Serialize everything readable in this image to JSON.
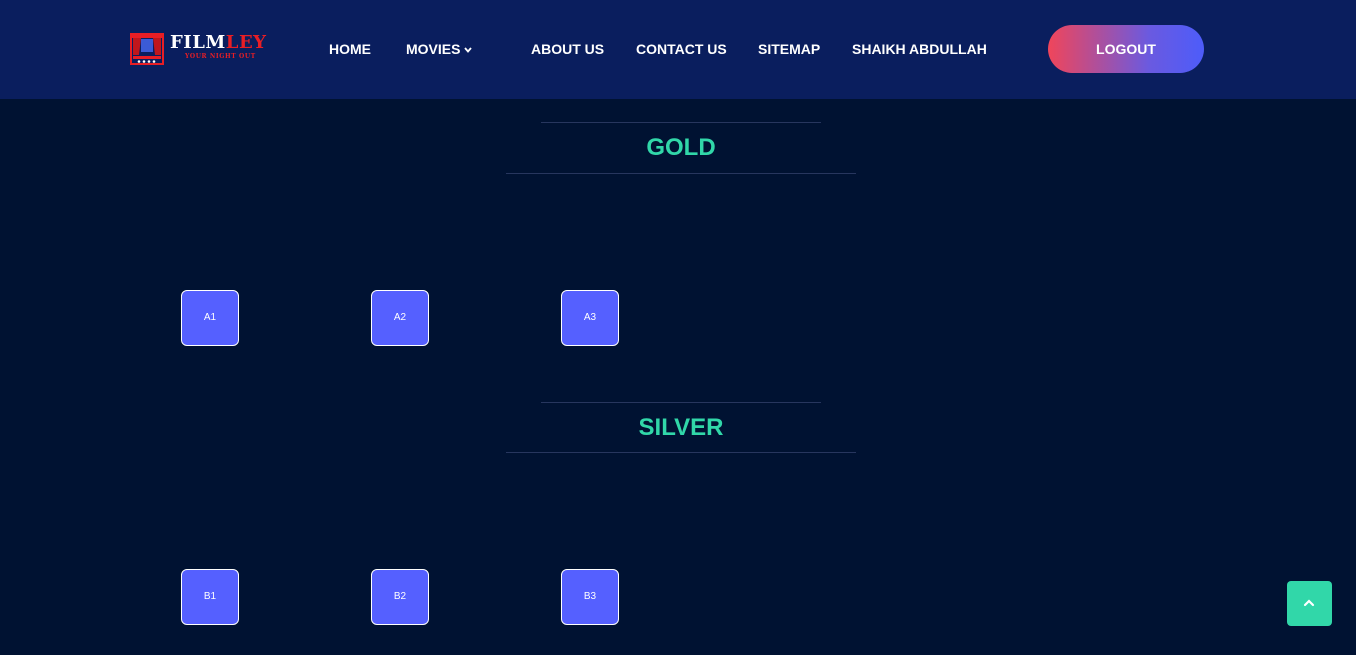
{
  "header": {
    "logo": {
      "word_part1": "FILM",
      "word_part2": "LEY",
      "tagline": "YOUR NIGHT OUT"
    },
    "nav": {
      "home": "HOME",
      "movies": "MOVIES",
      "about": "ABOUT US",
      "contact": "CONTACT US",
      "sitemap": "SITEMAP",
      "user": "SHAIKH ABDULLAH"
    },
    "logout_label": "LOGOUT"
  },
  "sections": {
    "gold": {
      "title": "GOLD",
      "seats": [
        "A1",
        "A2",
        "A3"
      ]
    },
    "silver": {
      "title": "SILVER",
      "seats": [
        "B1",
        "B2",
        "B3"
      ]
    }
  },
  "icons": {
    "movies_dropdown": "chevron-down-icon",
    "scroll_top": "chevron-up-icon",
    "logo": "theater-curtain-icon"
  },
  "colors": {
    "header_bg": "#0a1e5e",
    "page_bg": "#001232",
    "accent_green": "#31d7a9",
    "seat": "#5560ff",
    "logo_red": "#e81e25",
    "logout_gradient_start": "#f0455a",
    "logout_gradient_end": "#4d5cfa"
  }
}
